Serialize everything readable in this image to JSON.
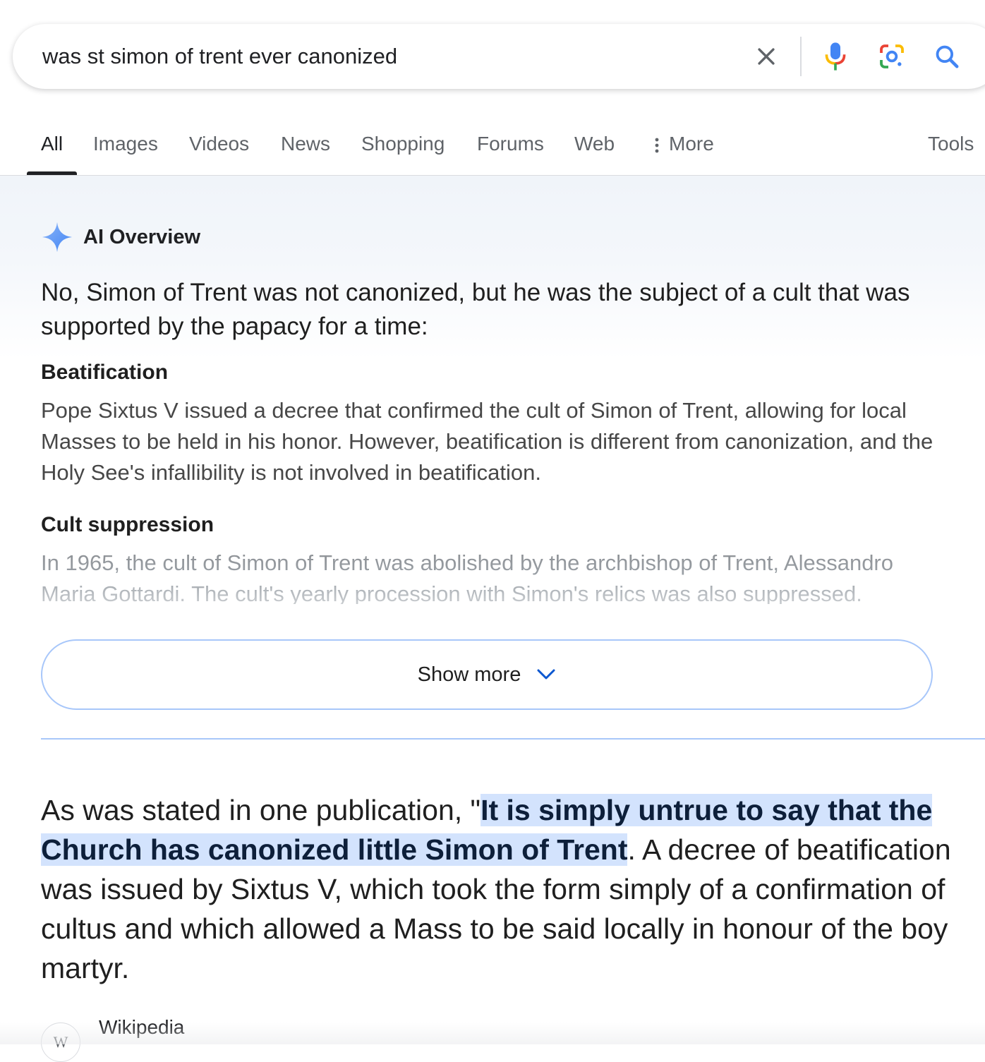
{
  "search": {
    "query": "was st simon of trent ever canonized"
  },
  "icons": {
    "clear": "close-icon",
    "voice": "microphone-icon",
    "lens": "camera-lens-icon",
    "search": "search-icon",
    "ai": "sparkle-icon",
    "show_more": "chevron-down-icon",
    "more": "vertical-dots-icon",
    "source": "wikipedia-logo-icon"
  },
  "tabs": {
    "items": [
      {
        "label": "All",
        "active": true
      },
      {
        "label": "Images"
      },
      {
        "label": "Videos"
      },
      {
        "label": "News"
      },
      {
        "label": "Shopping"
      },
      {
        "label": "Forums"
      },
      {
        "label": "Web"
      }
    ],
    "more_label": "More",
    "tools_label": "Tools"
  },
  "ai_overview": {
    "title": "AI Overview",
    "lead": "No, Simon of Trent was not canonized, but he was the subject of a cult that was supported by the papacy for a time:",
    "sections": [
      {
        "heading": "Beatification",
        "body": "Pope Sixtus V issued a decree that confirmed the cult of Simon of Trent, allowing for local Masses to be held in his honor. However, beatification is different from canonization, and the Holy See's infallibility is not involved in beatification."
      },
      {
        "heading": "Cult suppression",
        "body": "In 1965, the cult of Simon of Trent was abolished by the archbishop of Trent, Alessandro Maria Gottardi. The cult's yearly procession with Simon's relics was also suppressed."
      }
    ],
    "show_more_label": "Show more"
  },
  "snippet": {
    "before": "As was stated in one publication, \"",
    "highlight": "It is simply untrue to say that the Church has canonized little Simon of Trent",
    "after": ". A decree of beatification was issued by Sixtus V, which took the form simply of a confirmation of cultus and which allowed a Mass to be said locally in honour of the boy martyr."
  },
  "source": {
    "name": "Wikipedia",
    "favicon_text": "W"
  },
  "colors": {
    "accent_blue": "#4285f4",
    "highlight": "#d3e3fd",
    "show_more_border": "#a8c7fa"
  }
}
